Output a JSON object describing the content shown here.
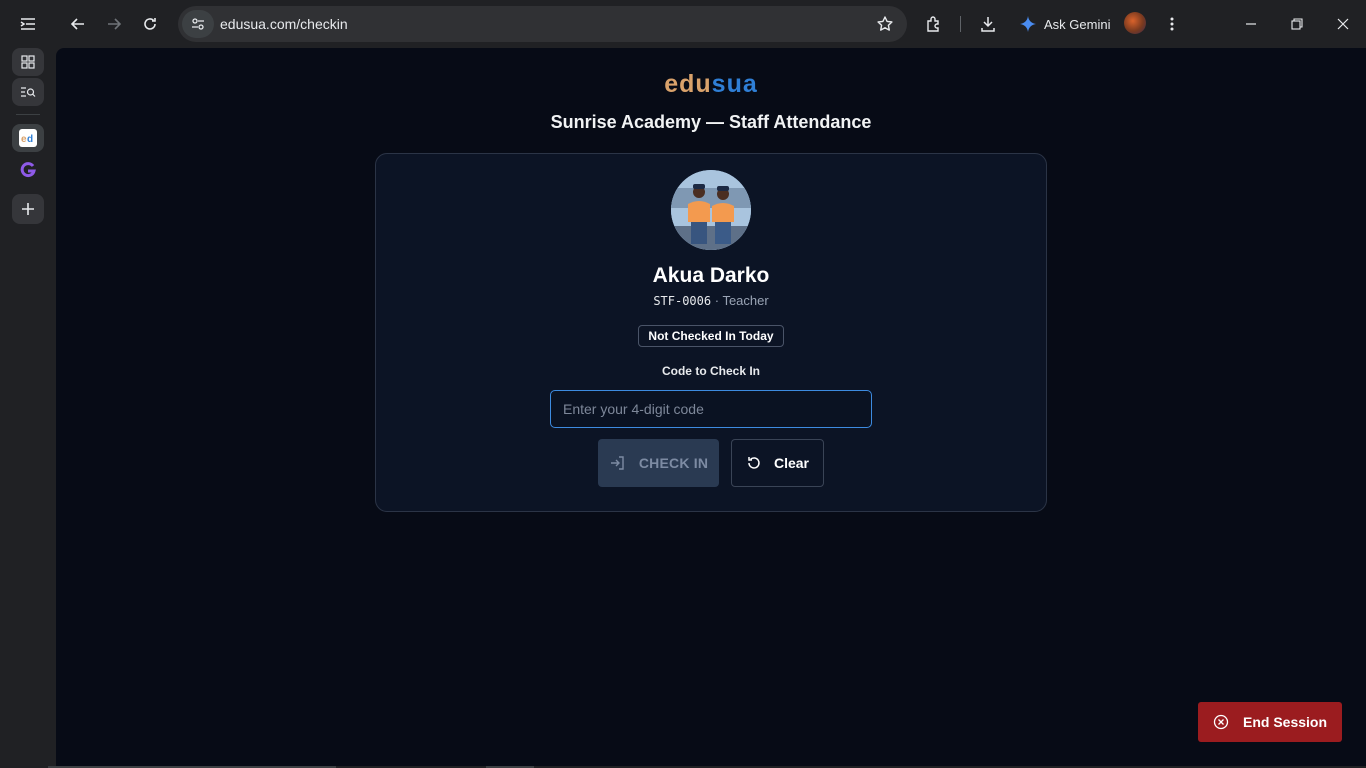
{
  "browser": {
    "url": "edusua.com/checkin",
    "gemini_label": "Ask Gemini"
  },
  "page": {
    "brand": {
      "part1": "edu",
      "part2": "sua"
    },
    "title": "Sunrise Academy — Staff Attendance",
    "staff": {
      "name": "Akua Darko",
      "id": "STF-0006",
      "separator": " · ",
      "role": "Teacher"
    },
    "status": "Not Checked In Today",
    "code_label": "Code to Check In",
    "code_input": {
      "value": "",
      "placeholder": "Enter your 4-digit code"
    },
    "checkin_label": "CHECK IN",
    "clear_label": "Clear",
    "end_session_label": "End Session"
  },
  "colors": {
    "page_bg": "#070b16",
    "card_bg": "#0c1425",
    "accent": "#3d8be0",
    "danger": "#9b1c1f",
    "brand_orange": "#d9a26b",
    "brand_blue": "#2f7fd6"
  }
}
